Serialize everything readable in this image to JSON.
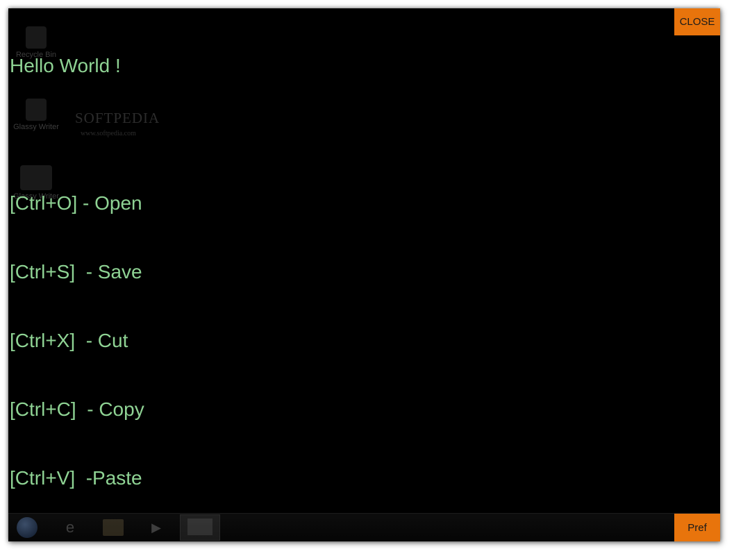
{
  "editor": {
    "lines": [
      "Hello World !",
      "",
      "[Ctrl+O] - Open",
      "[Ctrl+S]  - Save",
      "[Ctrl+X]  - Cut",
      "[Ctrl+C]  - Copy",
      "[Ctrl+V]  -Paste"
    ]
  },
  "buttons": {
    "close_label": "CLOSE",
    "pref_label": "Pref"
  },
  "desktop": {
    "icons": [
      {
        "label": "Recycle Bin",
        "icon": "recycle-bin-icon"
      },
      {
        "label": "Glassy Writer",
        "icon": "glassy-writer-icon"
      },
      {
        "label": "Glassy Writer",
        "icon": "glassy-writer-shortcut-icon"
      }
    ],
    "watermark": "SOFTPEDIA",
    "watermark_url": "www.softpedia.com"
  },
  "taskbar": {
    "items": [
      {
        "icon": "start-orb-icon"
      },
      {
        "icon": "internet-explorer-icon"
      },
      {
        "icon": "file-explorer-icon"
      },
      {
        "icon": "media-player-icon"
      },
      {
        "icon": "glassy-writer-taskbar-icon"
      }
    ]
  },
  "colors": {
    "background": "#000000",
    "text": "#8fd394",
    "accent": "#e8740c"
  }
}
